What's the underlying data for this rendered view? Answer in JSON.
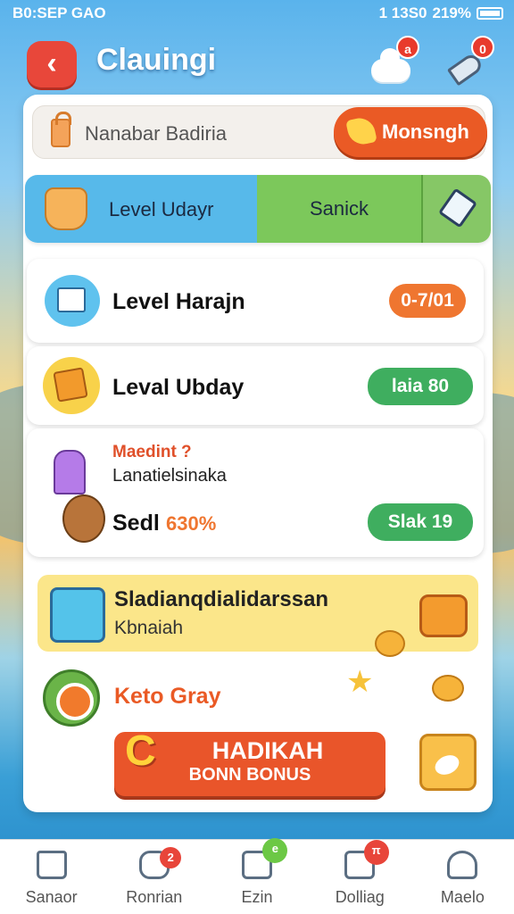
{
  "status_bar": {
    "left": "B0:SEP GAO",
    "right": "1 13S0",
    "battery": "219%"
  },
  "header": {
    "title": "Clauingi",
    "cloud_badge": "a",
    "rocket_badge": "0"
  },
  "search": {
    "placeholder": "Nanabar Badiria",
    "button_label": "Monsngh"
  },
  "tabs": [
    {
      "label": "Level Udayr"
    },
    {
      "label": "Sanick"
    }
  ],
  "cards": [
    {
      "title": "Level Harajn",
      "pill": "0‑7/01"
    },
    {
      "title": "Leval Ubday",
      "pill": "laia 80"
    },
    {
      "highlight": "Maedint ?",
      "subtitle": "Lanatielsinaka",
      "title": "Sedl",
      "percent": "630%",
      "pill": "Slak 19"
    }
  ],
  "promo": {
    "title": "Sladianqdialidarssan",
    "subtitle": "Kbnaiah"
  },
  "daily": {
    "label": "Keto Gray",
    "bonus_main": "HADIKAH",
    "bonus_sub": "BONN BONUS",
    "bonus_letter": "C"
  },
  "nav": [
    {
      "label": "Sanaor",
      "icon": "home-icon",
      "badge": ""
    },
    {
      "label": "Ronrian",
      "icon": "chat-icon",
      "badge": "2"
    },
    {
      "label": "Ezin",
      "icon": "camera-icon",
      "badge": "e"
    },
    {
      "label": "Dolliag",
      "icon": "map-icon",
      "badge": "π"
    },
    {
      "label": "Maelo",
      "icon": "profile-icon",
      "badge": ""
    }
  ],
  "colors": {
    "accent": "#ea5a25",
    "green": "#3fae5f",
    "blue": "#57b9ea"
  }
}
